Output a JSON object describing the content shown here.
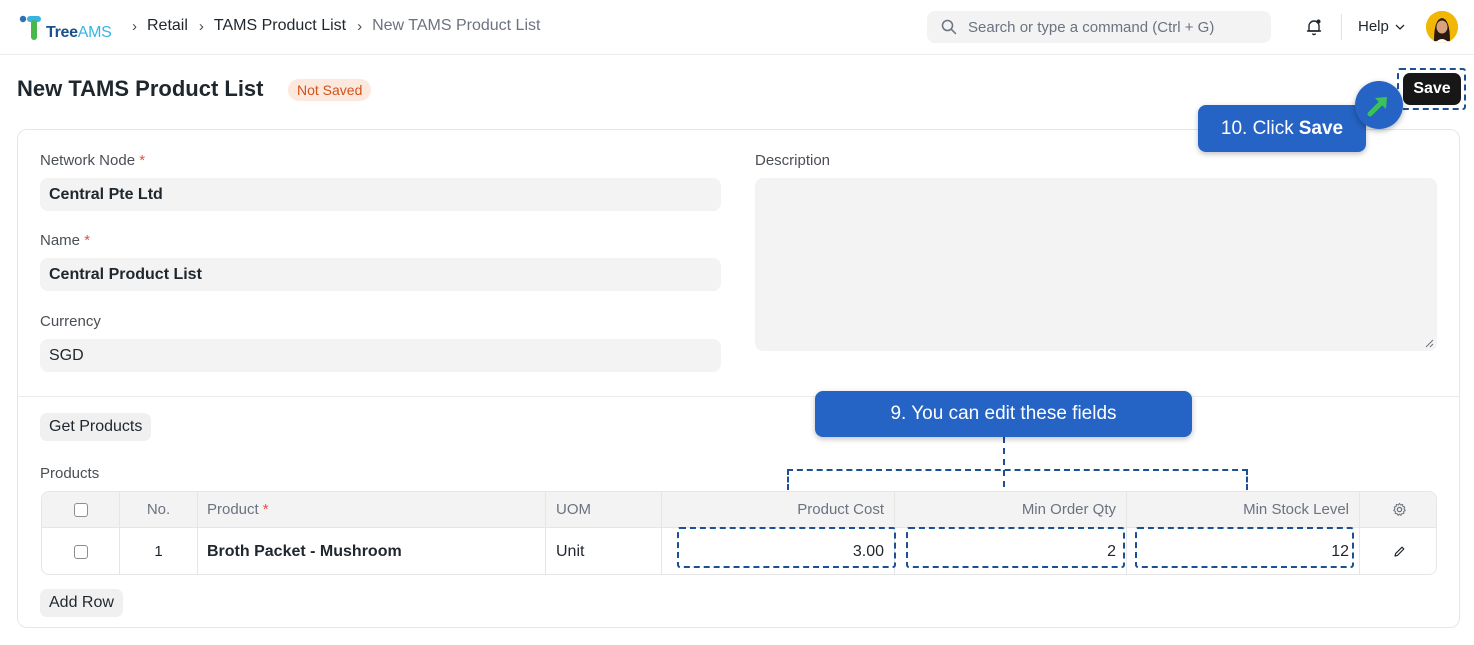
{
  "app": {
    "logo_tree": "Tree",
    "logo_ams": "AMS"
  },
  "breadcrumb": {
    "items": [
      "Retail",
      "TAMS Product List",
      "New TAMS Product List"
    ]
  },
  "search": {
    "placeholder": "Search or type a command (Ctrl + G)"
  },
  "nav": {
    "help_label": "Help"
  },
  "page": {
    "title": "New TAMS Product List",
    "status": "Not Saved",
    "save_label": "Save"
  },
  "form": {
    "network_node": {
      "label": "Network Node",
      "required": "*",
      "value": "Central Pte Ltd"
    },
    "name": {
      "label": "Name",
      "required": "*",
      "value": "Central Product List"
    },
    "currency": {
      "label": "Currency",
      "value": "SGD"
    },
    "description": {
      "label": "Description",
      "value": ""
    }
  },
  "products": {
    "get_products_label": "Get Products",
    "section_label": "Products",
    "columns": {
      "no": "No.",
      "product": "Product",
      "product_required": "*",
      "uom": "UOM",
      "product_cost": "Product Cost",
      "min_order_qty": "Min Order Qty",
      "min_stock_level": "Min Stock Level"
    },
    "rows": [
      {
        "no": "1",
        "product": "Broth Packet - Mushroom",
        "uom": "Unit",
        "product_cost": "3.00",
        "min_order_qty": "2",
        "min_stock_level": "12"
      }
    ],
    "add_row_label": "Add Row"
  },
  "tour": {
    "step9": "9. You can edit these fields",
    "step10_prefix": "10. Click",
    "step10_bold": "Save"
  },
  "colors": {
    "accent": "#2563c4",
    "status_bg": "#fde8dd",
    "status_text": "#d2521b",
    "dashed": "#1d4f95"
  }
}
